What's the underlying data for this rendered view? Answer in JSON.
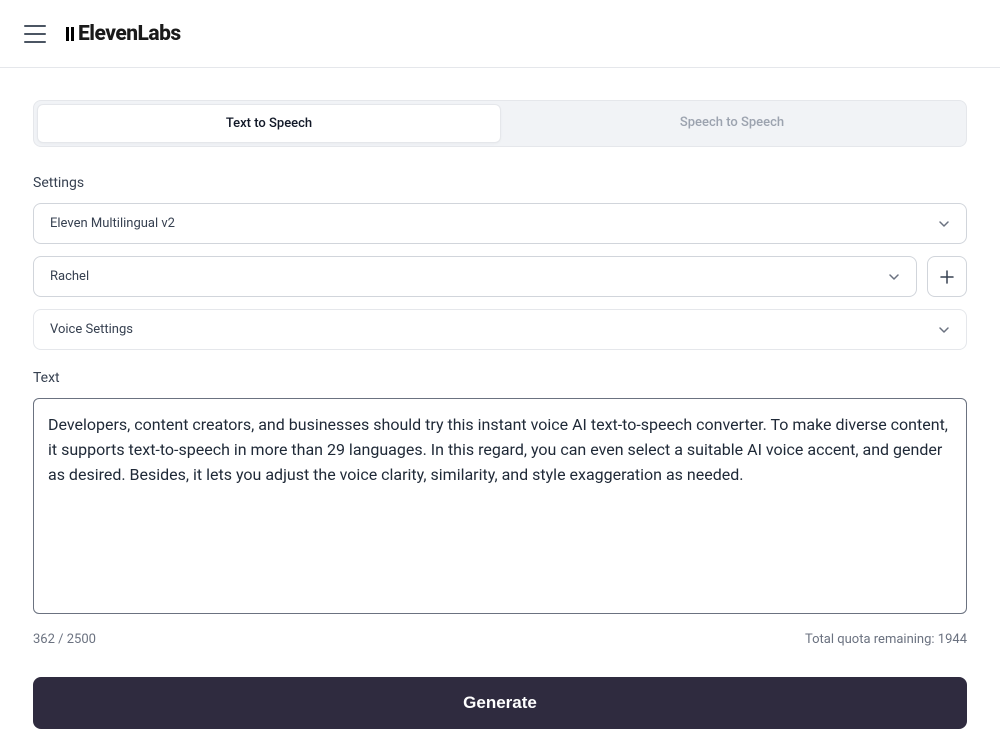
{
  "header": {
    "logo_text": "ElevenLabs"
  },
  "tabs": {
    "tts": "Text to Speech",
    "sts": "Speech to Speech"
  },
  "settings": {
    "label": "Settings",
    "model": "Eleven Multilingual v2",
    "voice": "Rachel",
    "voice_settings": "Voice Settings"
  },
  "text": {
    "label": "Text",
    "value": "Developers, content creators, and businesses should try this instant voice AI text-to-speech converter. To make diverse content, it supports text-to-speech in more than 29 languages. In this regard, you can even select a suitable AI voice accent, and gender as desired. Besides, it lets you adjust the voice clarity, similarity, and style exaggeration as needed."
  },
  "counter": {
    "chars": "362 / 2500",
    "quota": "Total quota remaining: 1944"
  },
  "buttons": {
    "generate": "Generate"
  }
}
